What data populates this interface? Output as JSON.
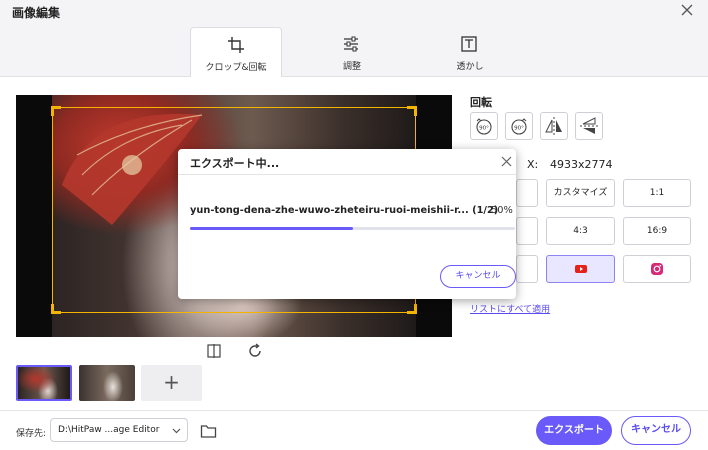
{
  "window": {
    "title": "画像編集"
  },
  "tabs": [
    {
      "label": "クロップ&回転",
      "icon": "crop-icon",
      "active": true
    },
    {
      "label": "調整",
      "icon": "sliders-icon",
      "active": false
    },
    {
      "label": "透かし",
      "icon": "watermark-icon",
      "active": false
    }
  ],
  "rotation": {
    "title": "回転",
    "buttons": [
      {
        "label": "90°",
        "icon": "rotate-left-icon"
      },
      {
        "label": "90°",
        "icon": "rotate-right-icon"
      },
      {
        "icon": "flip-horizontal-icon"
      },
      {
        "icon": "flip-vertical-icon"
      }
    ]
  },
  "size": {
    "label": "X:",
    "value": "4933x2774"
  },
  "ratios": [
    {
      "label": "",
      "active": false
    },
    {
      "label": "カスタマイズ",
      "active": false
    },
    {
      "label": "1:1",
      "active": false
    },
    {
      "label": "",
      "active": false
    },
    {
      "label": "4:3",
      "active": false
    },
    {
      "label": "16:9",
      "active": false
    },
    {
      "label": "",
      "active": false
    },
    {
      "label": "",
      "icon": "youtube-icon",
      "active": true
    },
    {
      "label": "",
      "icon": "instagram-icon",
      "active": false
    }
  ],
  "apply_all_link": "リストにすべて適用",
  "save": {
    "label": "保存先:",
    "path": "D:\\HitPaw ...age Editor"
  },
  "buttons": {
    "export": "エクスポート",
    "cancel": "キャンセル"
  },
  "dialog": {
    "title": "エクスポート中...",
    "file": "yun-tong-dena-zhe-wuwo-zheteiru-ruoi-meishii-r... (1/2)",
    "percent_text": "50%",
    "progress": 0.5,
    "cancel": "キャンセル"
  },
  "colors": {
    "accent": "#6a5af9",
    "crop_frame": "#f5b400",
    "selected_bg": "#e9e6ff"
  }
}
